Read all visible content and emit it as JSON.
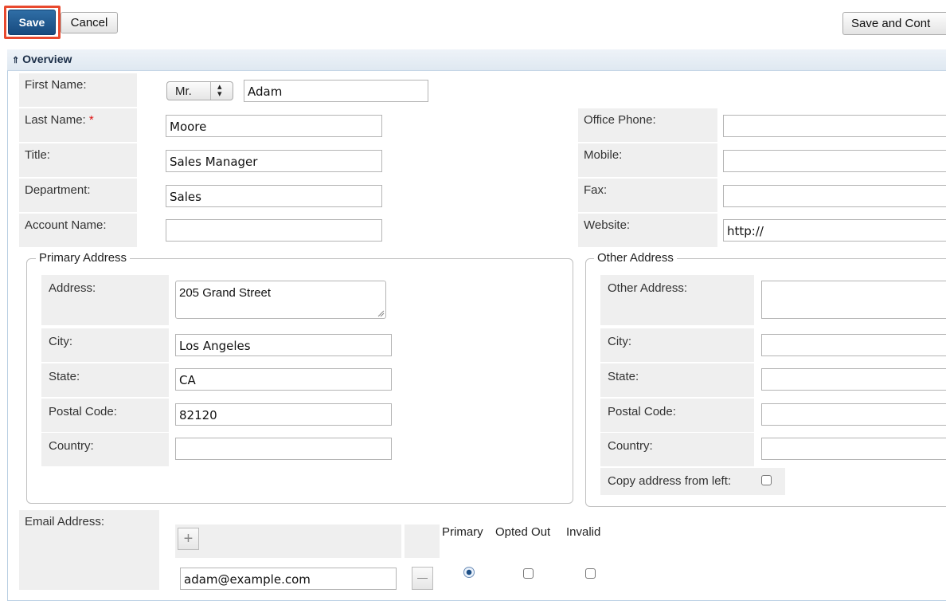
{
  "toolbar": {
    "save_label": "Save",
    "cancel_label": "Cancel",
    "save_continue_label": "Save and Cont"
  },
  "panel": {
    "toggle_glyph": "≈",
    "title": "Overview"
  },
  "fields": {
    "first_name": {
      "label": "First Name:",
      "salutation": "Mr.",
      "value": "Adam"
    },
    "last_name": {
      "label": "Last Name:",
      "required": "*",
      "value": "Moore"
    },
    "title": {
      "label": "Title:",
      "value": "Sales Manager"
    },
    "department": {
      "label": "Department:",
      "value": "Sales"
    },
    "account_name": {
      "label": "Account Name:",
      "value": ""
    },
    "office_phone": {
      "label": "Office Phone:",
      "value": ""
    },
    "mobile": {
      "label": "Mobile:",
      "value": ""
    },
    "fax": {
      "label": "Fax:",
      "value": ""
    },
    "website": {
      "label": "Website:",
      "value": "http://"
    }
  },
  "primary_address": {
    "legend": "Primary Address",
    "address": {
      "label": "Address:",
      "value": "205 Grand Street"
    },
    "city": {
      "label": "City:",
      "value": "Los Angeles"
    },
    "state": {
      "label": "State:",
      "value": "CA"
    },
    "postal_code": {
      "label": "Postal Code:",
      "value": "82120"
    },
    "country": {
      "label": "Country:",
      "value": ""
    }
  },
  "other_address": {
    "legend": "Other Address",
    "address": {
      "label": "Other Address:",
      "value": ""
    },
    "city": {
      "label": "City:",
      "value": ""
    },
    "state": {
      "label": "State:",
      "value": ""
    },
    "postal_code": {
      "label": "Postal Code:",
      "value": ""
    },
    "country": {
      "label": "Country:",
      "value": ""
    },
    "copy_label": "Copy address from left:"
  },
  "email": {
    "label": "Email Address:",
    "columns": [
      "Primary",
      "Opted Out",
      "Invalid"
    ],
    "rows": [
      {
        "address": "adam@example.com",
        "primary": true,
        "opted_out": false,
        "invalid": false
      }
    ]
  },
  "colors": {
    "save_bg": "#1f5a91",
    "highlight_border": "#e8492e",
    "label_bg": "#efefef",
    "required": "#dd1111"
  }
}
